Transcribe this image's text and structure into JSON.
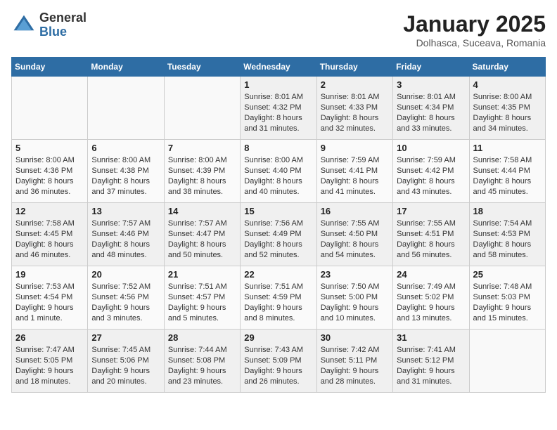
{
  "header": {
    "logo_general": "General",
    "logo_blue": "Blue",
    "month_title": "January 2025",
    "location": "Dolhasca, Suceava, Romania"
  },
  "weekdays": [
    "Sunday",
    "Monday",
    "Tuesday",
    "Wednesday",
    "Thursday",
    "Friday",
    "Saturday"
  ],
  "weeks": [
    [
      {
        "day": "",
        "info": ""
      },
      {
        "day": "",
        "info": ""
      },
      {
        "day": "",
        "info": ""
      },
      {
        "day": "1",
        "info": "Sunrise: 8:01 AM\nSunset: 4:32 PM\nDaylight: 8 hours\nand 31 minutes."
      },
      {
        "day": "2",
        "info": "Sunrise: 8:01 AM\nSunset: 4:33 PM\nDaylight: 8 hours\nand 32 minutes."
      },
      {
        "day": "3",
        "info": "Sunrise: 8:01 AM\nSunset: 4:34 PM\nDaylight: 8 hours\nand 33 minutes."
      },
      {
        "day": "4",
        "info": "Sunrise: 8:00 AM\nSunset: 4:35 PM\nDaylight: 8 hours\nand 34 minutes."
      }
    ],
    [
      {
        "day": "5",
        "info": "Sunrise: 8:00 AM\nSunset: 4:36 PM\nDaylight: 8 hours\nand 36 minutes."
      },
      {
        "day": "6",
        "info": "Sunrise: 8:00 AM\nSunset: 4:38 PM\nDaylight: 8 hours\nand 37 minutes."
      },
      {
        "day": "7",
        "info": "Sunrise: 8:00 AM\nSunset: 4:39 PM\nDaylight: 8 hours\nand 38 minutes."
      },
      {
        "day": "8",
        "info": "Sunrise: 8:00 AM\nSunset: 4:40 PM\nDaylight: 8 hours\nand 40 minutes."
      },
      {
        "day": "9",
        "info": "Sunrise: 7:59 AM\nSunset: 4:41 PM\nDaylight: 8 hours\nand 41 minutes."
      },
      {
        "day": "10",
        "info": "Sunrise: 7:59 AM\nSunset: 4:42 PM\nDaylight: 8 hours\nand 43 minutes."
      },
      {
        "day": "11",
        "info": "Sunrise: 7:58 AM\nSunset: 4:44 PM\nDaylight: 8 hours\nand 45 minutes."
      }
    ],
    [
      {
        "day": "12",
        "info": "Sunrise: 7:58 AM\nSunset: 4:45 PM\nDaylight: 8 hours\nand 46 minutes."
      },
      {
        "day": "13",
        "info": "Sunrise: 7:57 AM\nSunset: 4:46 PM\nDaylight: 8 hours\nand 48 minutes."
      },
      {
        "day": "14",
        "info": "Sunrise: 7:57 AM\nSunset: 4:47 PM\nDaylight: 8 hours\nand 50 minutes."
      },
      {
        "day": "15",
        "info": "Sunrise: 7:56 AM\nSunset: 4:49 PM\nDaylight: 8 hours\nand 52 minutes."
      },
      {
        "day": "16",
        "info": "Sunrise: 7:55 AM\nSunset: 4:50 PM\nDaylight: 8 hours\nand 54 minutes."
      },
      {
        "day": "17",
        "info": "Sunrise: 7:55 AM\nSunset: 4:51 PM\nDaylight: 8 hours\nand 56 minutes."
      },
      {
        "day": "18",
        "info": "Sunrise: 7:54 AM\nSunset: 4:53 PM\nDaylight: 8 hours\nand 58 minutes."
      }
    ],
    [
      {
        "day": "19",
        "info": "Sunrise: 7:53 AM\nSunset: 4:54 PM\nDaylight: 9 hours\nand 1 minute."
      },
      {
        "day": "20",
        "info": "Sunrise: 7:52 AM\nSunset: 4:56 PM\nDaylight: 9 hours\nand 3 minutes."
      },
      {
        "day": "21",
        "info": "Sunrise: 7:51 AM\nSunset: 4:57 PM\nDaylight: 9 hours\nand 5 minutes."
      },
      {
        "day": "22",
        "info": "Sunrise: 7:51 AM\nSunset: 4:59 PM\nDaylight: 9 hours\nand 8 minutes."
      },
      {
        "day": "23",
        "info": "Sunrise: 7:50 AM\nSunset: 5:00 PM\nDaylight: 9 hours\nand 10 minutes."
      },
      {
        "day": "24",
        "info": "Sunrise: 7:49 AM\nSunset: 5:02 PM\nDaylight: 9 hours\nand 13 minutes."
      },
      {
        "day": "25",
        "info": "Sunrise: 7:48 AM\nSunset: 5:03 PM\nDaylight: 9 hours\nand 15 minutes."
      }
    ],
    [
      {
        "day": "26",
        "info": "Sunrise: 7:47 AM\nSunset: 5:05 PM\nDaylight: 9 hours\nand 18 minutes."
      },
      {
        "day": "27",
        "info": "Sunrise: 7:45 AM\nSunset: 5:06 PM\nDaylight: 9 hours\nand 20 minutes."
      },
      {
        "day": "28",
        "info": "Sunrise: 7:44 AM\nSunset: 5:08 PM\nDaylight: 9 hours\nand 23 minutes."
      },
      {
        "day": "29",
        "info": "Sunrise: 7:43 AM\nSunset: 5:09 PM\nDaylight: 9 hours\nand 26 minutes."
      },
      {
        "day": "30",
        "info": "Sunrise: 7:42 AM\nSunset: 5:11 PM\nDaylight: 9 hours\nand 28 minutes."
      },
      {
        "day": "31",
        "info": "Sunrise: 7:41 AM\nSunset: 5:12 PM\nDaylight: 9 hours\nand 31 minutes."
      },
      {
        "day": "",
        "info": ""
      }
    ]
  ]
}
